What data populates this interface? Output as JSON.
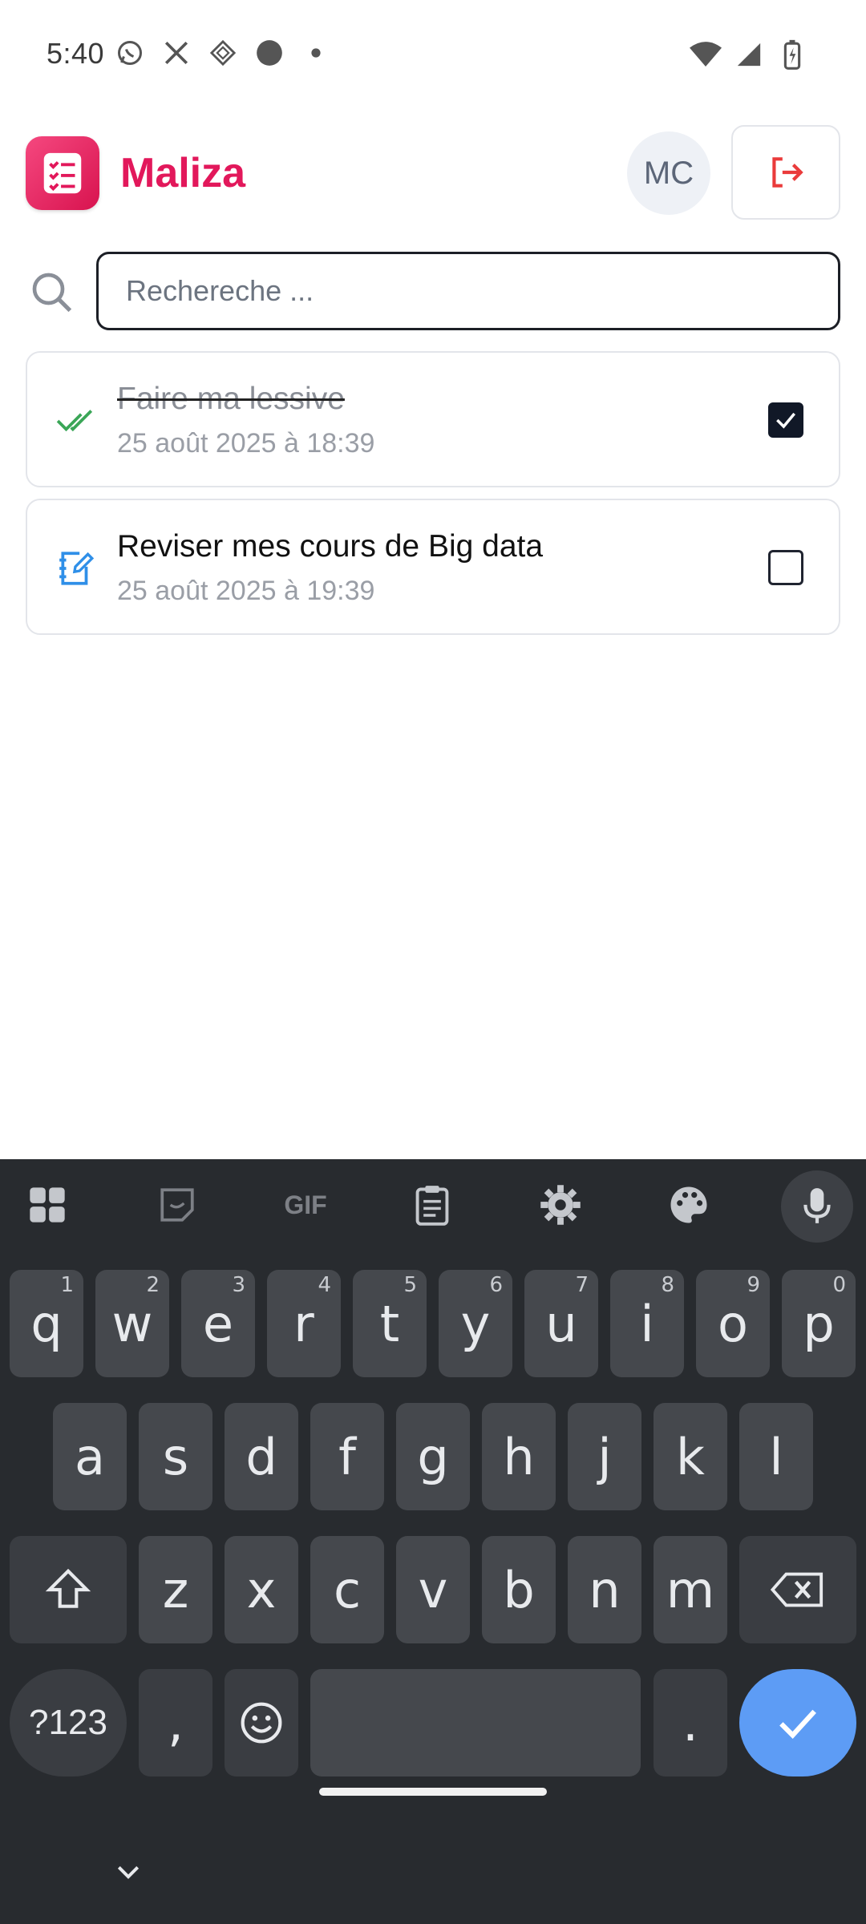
{
  "status_bar": {
    "time": "5:40",
    "left_icons": [
      "whatsapp-icon",
      "x-icon",
      "app-icon",
      "circle-icon",
      "dot-icon"
    ],
    "right_icons": [
      "wifi-icon",
      "signal-icon",
      "battery-icon"
    ]
  },
  "header": {
    "app_title": "Maliza",
    "avatar_initials": "MC",
    "logout_icon": "logout-icon",
    "brand_color": "#e2185b"
  },
  "search": {
    "placeholder": "Rechereche ...",
    "value": ""
  },
  "tasks": [
    {
      "title": "Faire ma lessive",
      "date": "25 août 2025 à 18:39",
      "done": true,
      "icon": "double-check-icon"
    },
    {
      "title": "Reviser mes cours de Big data",
      "date": "25 août 2025 à 19:39",
      "done": false,
      "icon": "edit-note-icon"
    }
  ],
  "keyboard": {
    "toolbar": [
      "apps-grid-icon",
      "sticker-icon",
      "GIF",
      "clipboard-icon",
      "settings-icon",
      "palette-icon",
      "mic-icon"
    ],
    "gif_label": "GIF",
    "row1": [
      "q",
      "w",
      "e",
      "r",
      "t",
      "y",
      "u",
      "i",
      "o",
      "p"
    ],
    "row1_hints": [
      "1",
      "2",
      "3",
      "4",
      "5",
      "6",
      "7",
      "8",
      "9",
      "0"
    ],
    "row2": [
      "a",
      "s",
      "d",
      "f",
      "g",
      "h",
      "j",
      "k",
      "l"
    ],
    "row3": [
      "z",
      "x",
      "c",
      "v",
      "b",
      "n",
      "m"
    ],
    "symbols_label": "?123",
    "comma": ",",
    "period": ".",
    "accent_color": "#5d9cf5"
  }
}
